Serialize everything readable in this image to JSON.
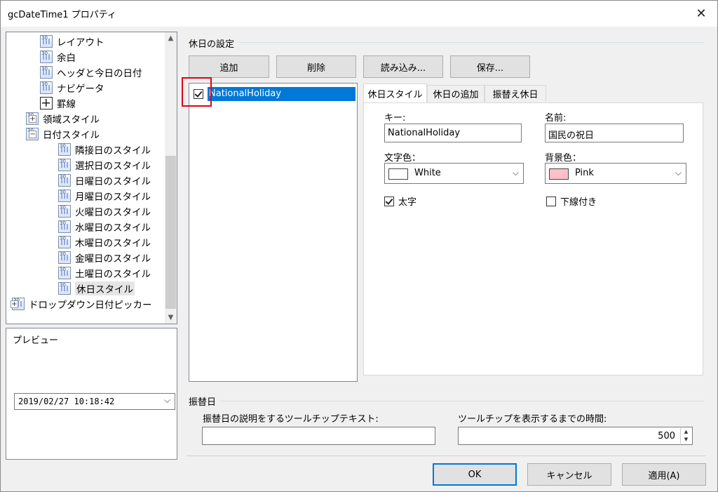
{
  "window": {
    "title": "gcDateTime1 プロパティ",
    "close_glyph": "✕"
  },
  "tree": {
    "items": [
      {
        "label": "レイアウト",
        "icon": "layout-icon"
      },
      {
        "label": "余白",
        "icon": "calendar-icon"
      },
      {
        "label": "ヘッダと今日の日付",
        "icon": "calendar-icon"
      },
      {
        "label": "ナビゲータ",
        "icon": "calendar-icon"
      },
      {
        "label": "罫線",
        "icon": "grid-icon"
      },
      {
        "label": "領域スタイル",
        "icon": "calendar-icon",
        "expander": "+"
      },
      {
        "label": "日付スタイル",
        "icon": "calendar-icon",
        "expander": "−"
      },
      {
        "label": "隣接日のスタイル",
        "icon": "calendar-icon"
      },
      {
        "label": "選択日のスタイル",
        "icon": "calendar-icon"
      },
      {
        "label": "日曜日のスタイル",
        "icon": "calendar-icon"
      },
      {
        "label": "月曜日のスタイル",
        "icon": "calendar-icon"
      },
      {
        "label": "火曜日のスタイル",
        "icon": "calendar-icon"
      },
      {
        "label": "水曜日のスタイル",
        "icon": "calendar-icon"
      },
      {
        "label": "木曜日のスタイル",
        "icon": "calendar-icon"
      },
      {
        "label": "金曜日のスタイル",
        "icon": "calendar-icon"
      },
      {
        "label": "土曜日のスタイル",
        "icon": "calendar-icon"
      },
      {
        "label": "休日スタイル",
        "icon": "calendar-icon",
        "selected": true
      },
      {
        "label": "ドロップダウン日付ピッカー",
        "icon": "calendar-icon",
        "expander": "+"
      }
    ],
    "scroll_up": "▲",
    "scroll_down": "▼"
  },
  "preview": {
    "label": "プレビュー",
    "value": "2019/02/27 10:18:42",
    "chevron": "⌵"
  },
  "holiday_settings": {
    "title": "休日の設定",
    "buttons": {
      "add": "追加",
      "delete": "削除",
      "load": "読み込み...",
      "save": "保存..."
    },
    "list": [
      {
        "label": "NationalHoliday",
        "checked": true,
        "selected": true
      }
    ],
    "tabs": [
      "休日スタイル",
      "休日の追加",
      "振替え休日"
    ],
    "active_tab": 0,
    "style_page": {
      "key_label": "キー:",
      "key_value": "NationalHoliday",
      "name_label": "名前:",
      "name_value": "国民の祝日",
      "fore_label": "文字色：",
      "fore_value": "White",
      "fore_color": "#ffffff",
      "back_label": "背景色：",
      "back_value": "Pink",
      "back_color": "#ffc0cb",
      "bold_label": "太字",
      "bold_checked": true,
      "underline_label": "下線付き",
      "underline_checked": false
    }
  },
  "substitute": {
    "title": "振替日",
    "tooltip_text_label": "振替日の説明をするツールチップテキスト:",
    "tooltip_text_value": "",
    "tooltip_delay_label": "ツールチップを表示するまでの時間:",
    "tooltip_delay_value": "500"
  },
  "footer": {
    "ok": "OK",
    "cancel": "キャンセル",
    "apply": "適用(A)"
  },
  "colors": {
    "selection": "#0078d7",
    "highlight_box": "#e0001b",
    "default_button_border": "#0078d7"
  }
}
